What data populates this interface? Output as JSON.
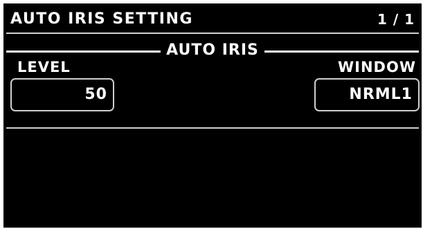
{
  "header": {
    "title": "AUTO IRIS SETTING",
    "page_indicator": "1 / 1"
  },
  "section": {
    "title": "AUTO IRIS"
  },
  "fields": {
    "level": {
      "label": "LEVEL",
      "value": "50"
    },
    "window": {
      "label": "WINDOW",
      "value": "NRML1"
    }
  },
  "colors": {
    "background": "#000000",
    "text": "#ffffff",
    "divider": "#d0d0d0",
    "box_border": "#cfcfcf"
  }
}
